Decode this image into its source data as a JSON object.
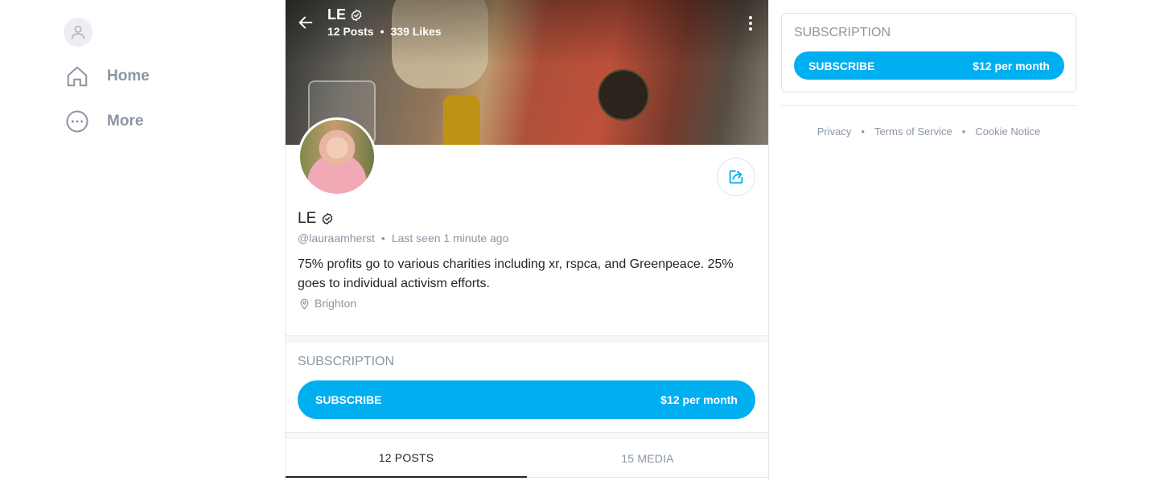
{
  "sidebar": {
    "items": [
      {
        "label": "Home",
        "icon": "home-icon"
      },
      {
        "label": "More",
        "icon": "more-circle-icon"
      }
    ]
  },
  "header": {
    "name": "LE",
    "posts": "12 Posts",
    "likes": "339 Likes"
  },
  "profile": {
    "name": "LE",
    "handle": "@lauraamherst",
    "last_seen": "Last seen 1 minute ago",
    "bio": "75% profits go to various charities including xr, rspca, and Greenpeace. 25% goes to individual activism efforts.",
    "location": "Brighton"
  },
  "subscription": {
    "title": "SUBSCRIPTION",
    "button_label": "SUBSCRIBE",
    "price": "$12 per month"
  },
  "tabs": [
    {
      "label": "12 POSTS",
      "active": true
    },
    {
      "label": "15 MEDIA",
      "active": false
    }
  ],
  "right_panel": {
    "title": "SUBSCRIPTION",
    "button_label": "SUBSCRIBE",
    "price": "$12 per month"
  },
  "footer": {
    "links": [
      "Privacy",
      "Terms of Service",
      "Cookie Notice"
    ]
  },
  "colors": {
    "accent": "#00aff0",
    "muted_text": "#8a96a3",
    "primary_text": "#242529"
  }
}
